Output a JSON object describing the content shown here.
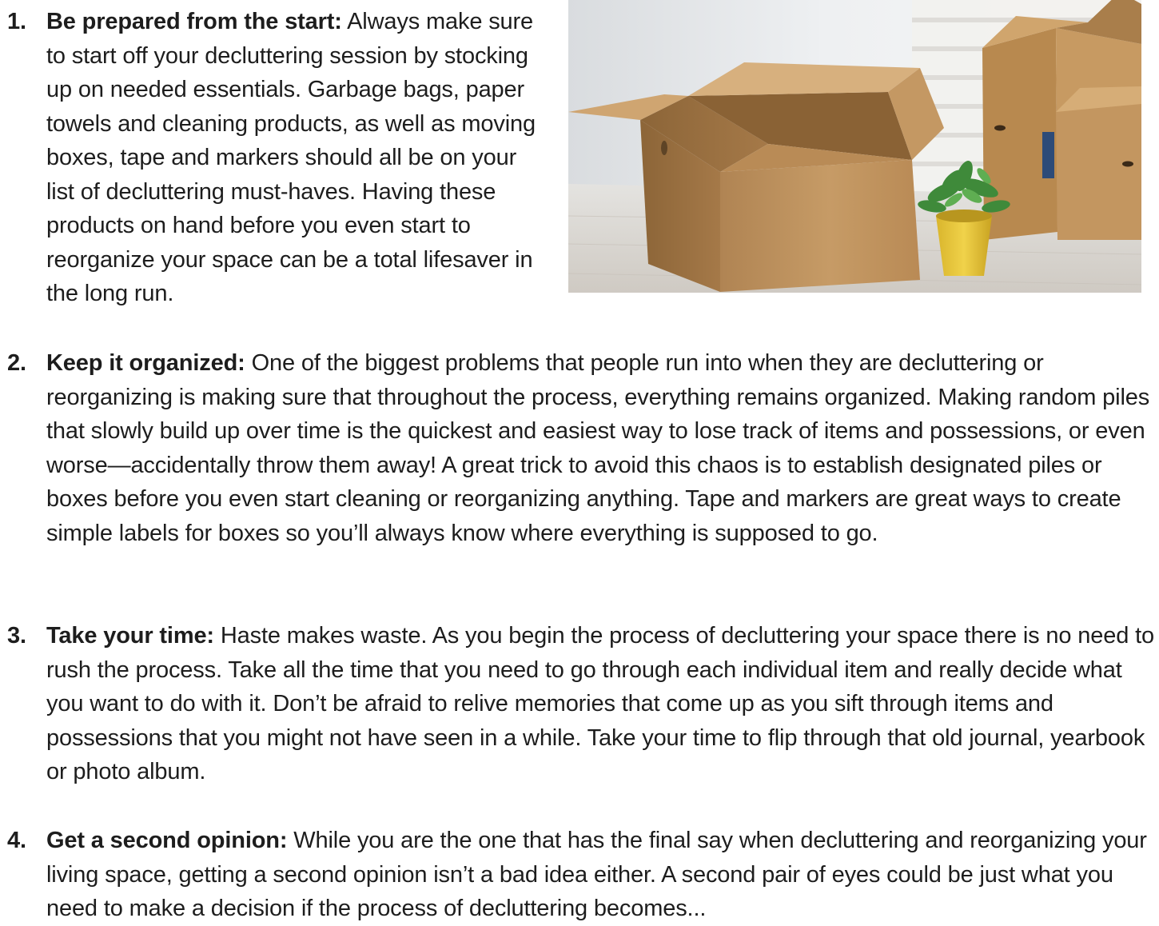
{
  "tips": [
    {
      "number": "1.",
      "lead": "Be prepared from the start:",
      "text": " Always make sure to start off your decluttering session by stocking up on needed essentials. Garbage bags, paper towels and cleaning products, as well as moving boxes, tape and markers should all be on your list of decluttering must-haves. Having these products on hand before you even start to reorganize your space can be a total lifesaver in the long run."
    },
    {
      "number": "2.",
      "lead": "Keep it organized:",
      "text": " One of the biggest problems that people run into when they are decluttering or reorganizing is making sure that throughout the process, everything remains organized. Making random piles that slowly build up over time is the quickest and easiest way to lose track of items and possessions, or even worse—accidentally throw them away! A great trick to avoid this chaos is to establish designated piles or boxes before you even start cleaning or reorganizing anything. Tape and markers are great ways to create simple labels for boxes so you’ll always know where everything is supposed to go."
    },
    {
      "number": "3.",
      "lead": "Take your time:",
      "text": " Haste makes waste. As you begin the process of decluttering your space there is no need to rush the process. Take all the time that you need to go through each individual item and really decide what you want to do with it. Don’t be afraid to relive memories that come up as you sift through items and possessions that you might not have seen in a while. Take your time to flip through that old journal, yearbook or photo album."
    },
    {
      "number": "4.",
      "lead": "Get a second opinion:",
      "text": " While you are the one that has the final say when decluttering and reorganizing your living space, getting a second opinion isn’t a bad idea either. A second pair of eyes could be just what you need to make a decision if the process of decluttering becomes..."
    }
  ],
  "photo": {
    "subject": "cardboard-moving-boxes-with-potted-plant"
  }
}
